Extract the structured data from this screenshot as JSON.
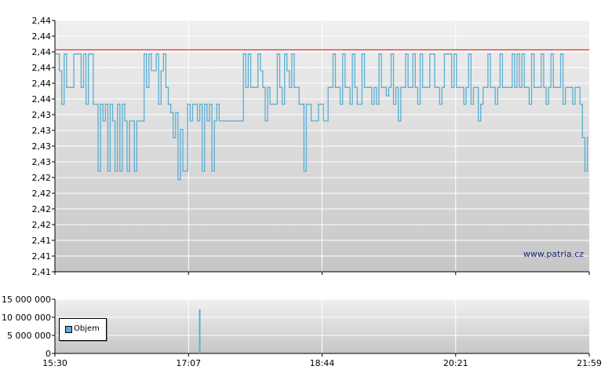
{
  "chart_data": [
    {
      "type": "line",
      "name": "price-chart",
      "yticks": [
        "2,41",
        "2,41",
        "2,41",
        "2,42",
        "2,42",
        "2,42",
        "2,42",
        "2,43",
        "2,43",
        "2,43",
        "2,43",
        "2,44",
        "2,44",
        "2,44",
        "2,44",
        "2,44",
        "2,44"
      ],
      "ylim": [
        2.41,
        2.44
      ],
      "grid": true,
      "reference_line": {
        "value": 2.4365,
        "color": "#ff0000"
      },
      "series_color": "#5aaed3",
      "x_range": [
        "15:30",
        "21:59"
      ],
      "series": [
        {
          "values": [
            2.436,
            2.436,
            2.434,
            2.43,
            2.436,
            2.432,
            2.432,
            2.432,
            2.436,
            2.436,
            2.436,
            2.432,
            2.436,
            2.43,
            2.436,
            2.436,
            2.43,
            2.43,
            2.422,
            2.43,
            2.428,
            2.43,
            2.422,
            2.43,
            2.428,
            2.422,
            2.43,
            2.422,
            2.43,
            2.428,
            2.422,
            2.428,
            2.428,
            2.422,
            2.428,
            2.428,
            2.428,
            2.436,
            2.432,
            2.436,
            2.434,
            2.434,
            2.436,
            2.43,
            2.434,
            2.436,
            2.432,
            2.43,
            2.429,
            2.426,
            2.429,
            2.421,
            2.427,
            2.422,
            2.422,
            2.43,
            2.428,
            2.43,
            2.43,
            2.428,
            2.43,
            2.422,
            2.43,
            2.428,
            2.43,
            2.422,
            2.428,
            2.43,
            2.428,
            2.428,
            2.428,
            2.428,
            2.428,
            2.428,
            2.428,
            2.428,
            2.428,
            2.428,
            2.436,
            2.432,
            2.436,
            2.432,
            2.432,
            2.432,
            2.436,
            2.434,
            2.432,
            2.428,
            2.432,
            2.43,
            2.43,
            2.43,
            2.436,
            2.432,
            2.43,
            2.436,
            2.434,
            2.432,
            2.436,
            2.432,
            2.432,
            2.43,
            2.43,
            2.422,
            2.43,
            2.43,
            2.428,
            2.428,
            2.428,
            2.43,
            2.43,
            2.428,
            2.428,
            2.432,
            2.432,
            2.436,
            2.432,
            2.432,
            2.43,
            2.436,
            2.432,
            2.432,
            2.43,
            2.436,
            2.432,
            2.43,
            2.43,
            2.436,
            2.432,
            2.432,
            2.432,
            2.43,
            2.432,
            2.43,
            2.436,
            2.432,
            2.432,
            2.431,
            2.432,
            2.436,
            2.43,
            2.432,
            2.428,
            2.432,
            2.432,
            2.436,
            2.432,
            2.432,
            2.436,
            2.432,
            2.43,
            2.436,
            2.432,
            2.432,
            2.432,
            2.436,
            2.436,
            2.432,
            2.432,
            2.43,
            2.432,
            2.436,
            2.436,
            2.436,
            2.432,
            2.436,
            2.432,
            2.432,
            2.432,
            2.43,
            2.432,
            2.436,
            2.43,
            2.432,
            2.432,
            2.428,
            2.43,
            2.432,
            2.432,
            2.436,
            2.432,
            2.432,
            2.43,
            2.432,
            2.436,
            2.432,
            2.432,
            2.432,
            2.432,
            2.436,
            2.432,
            2.436,
            2.432,
            2.436,
            2.432,
            2.432,
            2.43,
            2.436,
            2.432,
            2.432,
            2.432,
            2.436,
            2.432,
            2.43,
            2.432,
            2.436,
            2.432,
            2.432,
            2.432,
            2.436,
            2.43,
            2.432,
            2.432,
            2.432,
            2.43,
            2.432,
            2.432,
            2.43,
            2.426,
            2.422,
            2.426
          ]
        }
      ]
    },
    {
      "type": "bar",
      "name": "volume-chart",
      "yticks": [
        "0",
        "5 000 000",
        "10 000 000",
        "15 000 000"
      ],
      "ylim": [
        0,
        15000000
      ],
      "grid": true,
      "xticks": [
        "15:30",
        "17:07",
        "18:44",
        "20:21",
        "21:59"
      ],
      "series": [
        {
          "name": "Objem",
          "color": "#5aaed3",
          "x_fraction": 0.271,
          "value": 12200000
        }
      ]
    }
  ],
  "watermark": "www.patria.cz"
}
